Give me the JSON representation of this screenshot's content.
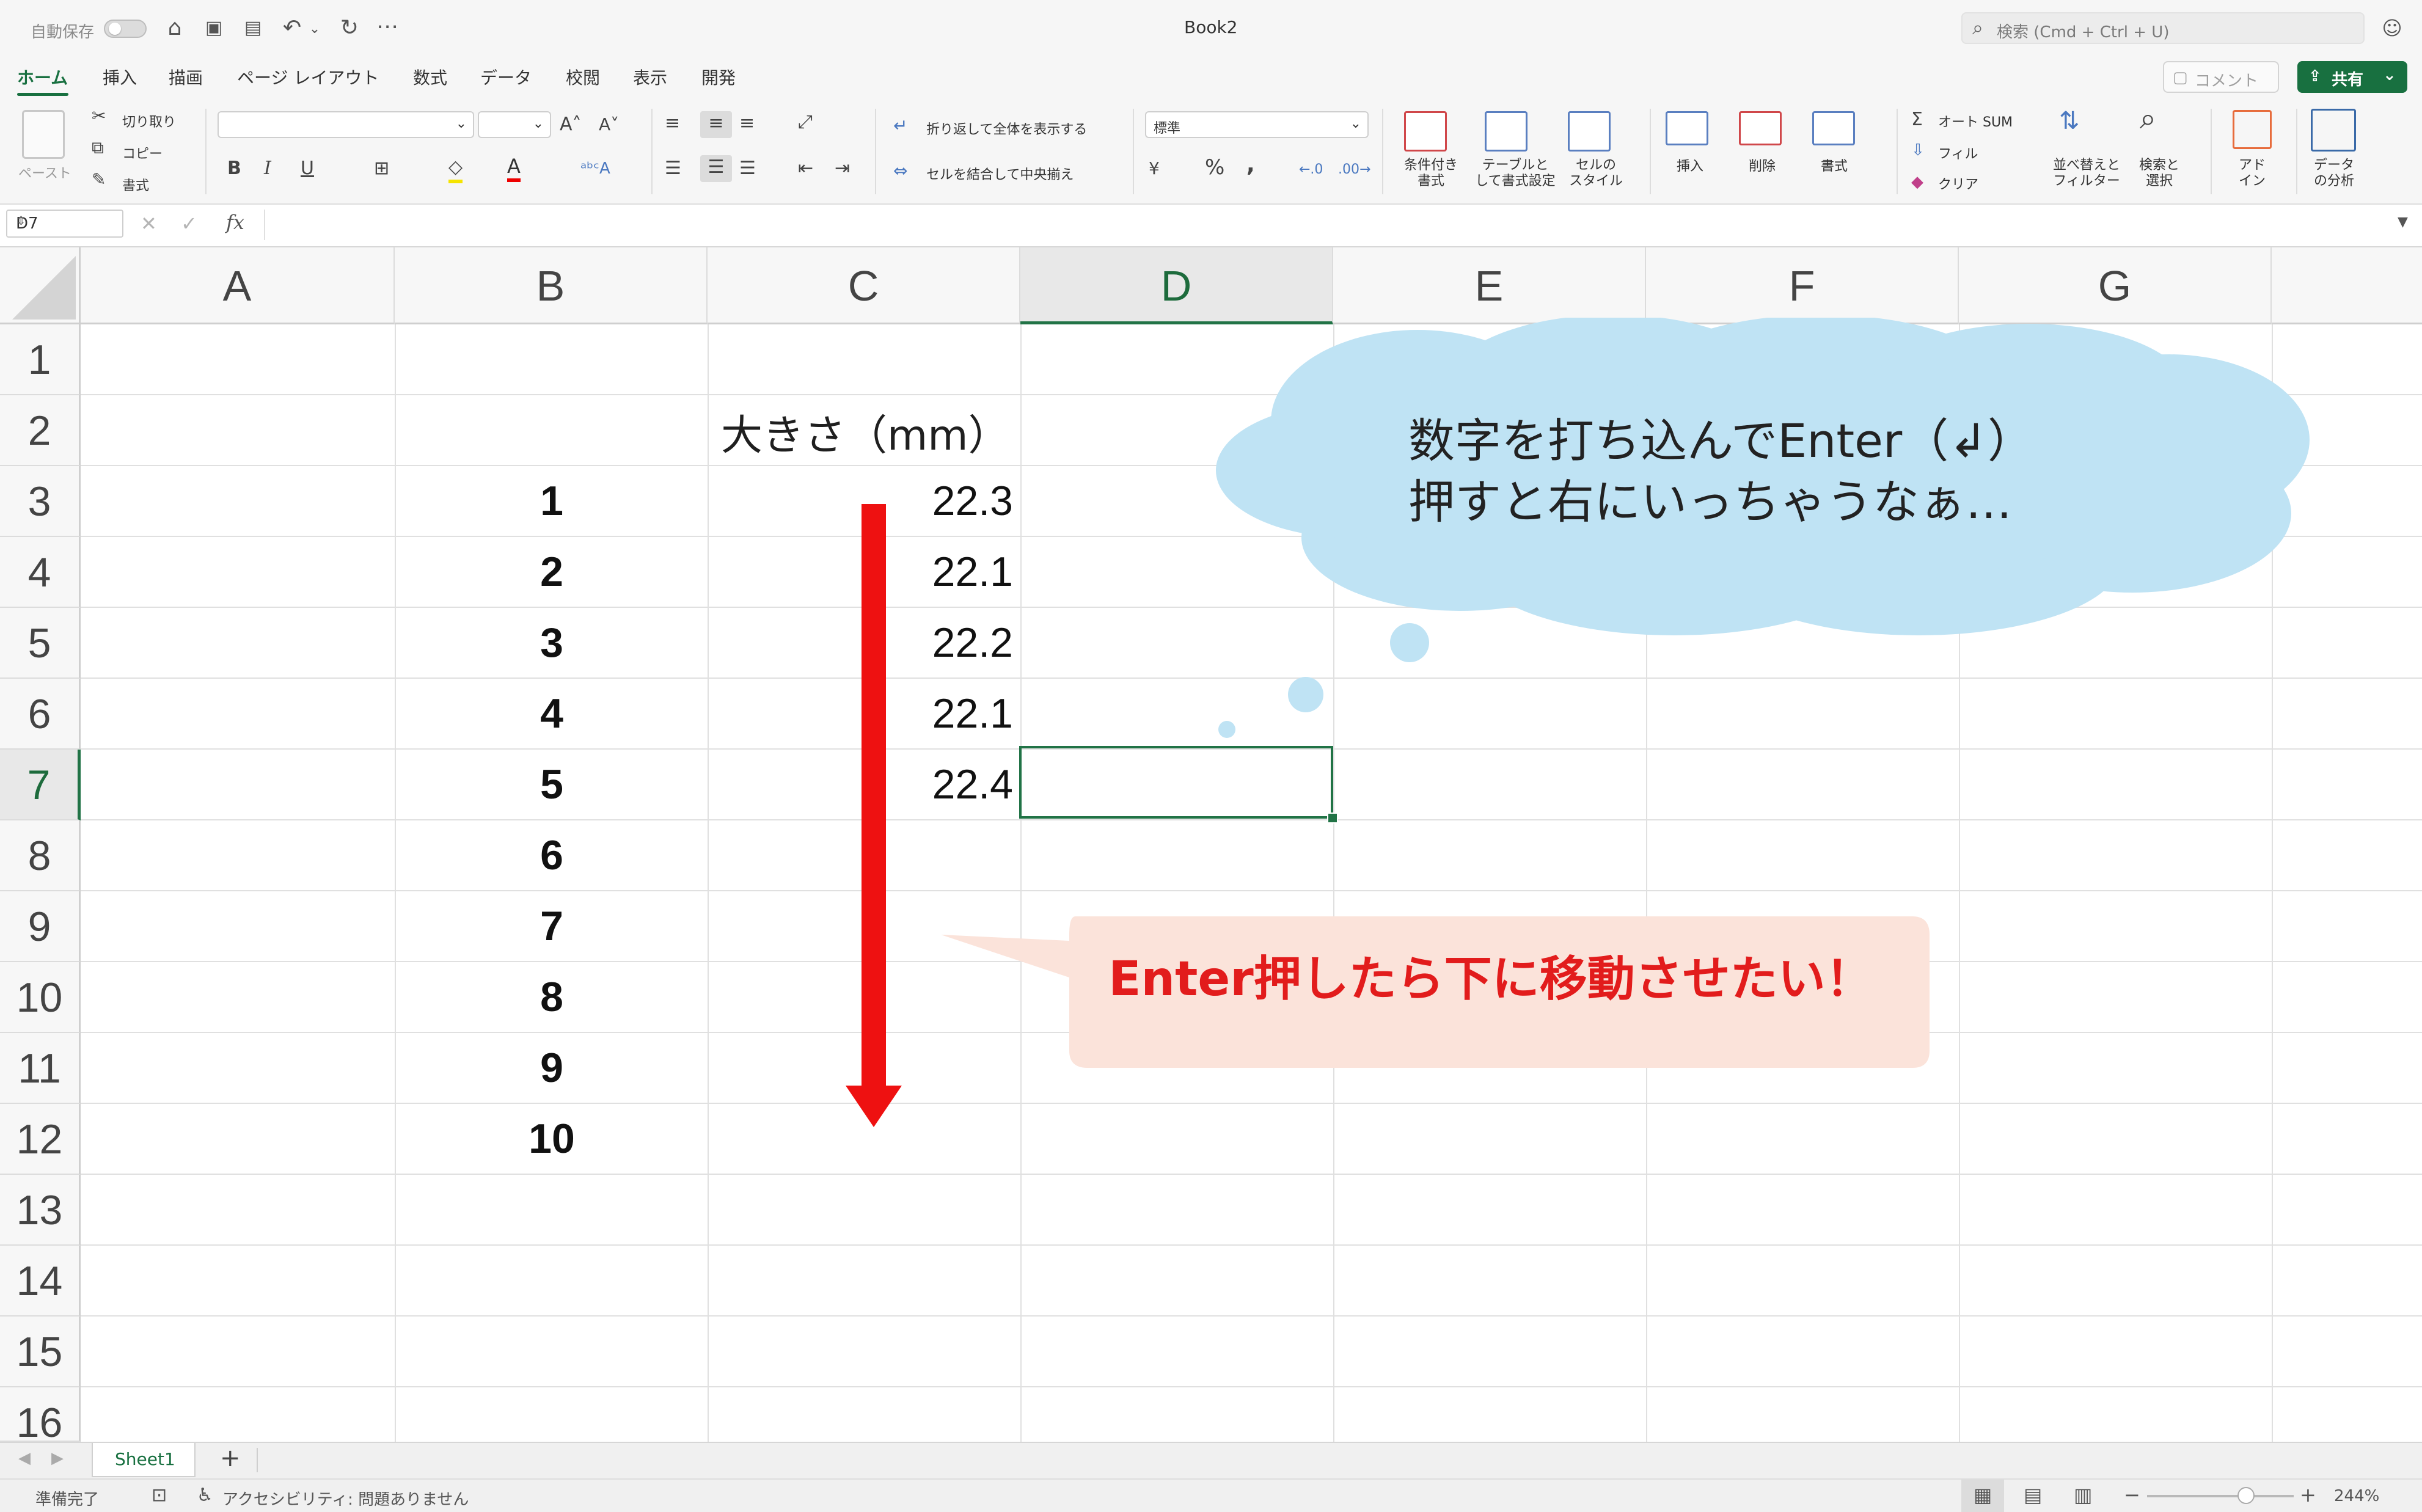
{
  "window": {
    "title": "Book2",
    "autosave_label": "自動保存",
    "search_placeholder": "検索 (Cmd + Ctrl + U)"
  },
  "ribbon_tabs": [
    "ホーム",
    "挿入",
    "描画",
    "ページ レイアウト",
    "数式",
    "データ",
    "校閲",
    "表示",
    "開発"
  ],
  "header_buttons": {
    "comment": "コメント",
    "share": "共有"
  },
  "ribbon": {
    "clipboard": {
      "paste": "ペースト",
      "cut": "切り取り",
      "copy": "コピー",
      "format": "書式"
    },
    "font": {
      "bold": "B",
      "italic": "I",
      "underline": "U",
      "font_name": "",
      "font_size": ""
    },
    "alignment": {
      "wrap": "折り返して全体を表示する",
      "merge": "セルを結合して中央揃え"
    },
    "number": {
      "format": "標準",
      "percent": "%",
      "comma": ","
    },
    "styles": {
      "conditional": "条件付き\n書式",
      "table": "テーブルと\nして書式設定",
      "cell": "セルの\nスタイル"
    },
    "cells": {
      "insert": "挿入",
      "delete": "削除",
      "format": "書式"
    },
    "editing": {
      "autosum": "オート SUM",
      "fill": "フィル",
      "clear": "クリア",
      "sort": "並べ替えと\nフィルター",
      "find": "検索と\n選択"
    },
    "addins": {
      "addin": "アド\nイン",
      "analysis": "データ\nの分析"
    }
  },
  "formula_bar": {
    "name_box": "D7",
    "fx": "fx",
    "formula": ""
  },
  "sheet": {
    "columns": [
      "A",
      "B",
      "C",
      "D",
      "E",
      "F",
      "G"
    ],
    "rows": [
      "1",
      "2",
      "3",
      "4",
      "5",
      "6",
      "7",
      "8",
      "9",
      "10",
      "11",
      "12",
      "13",
      "14",
      "15",
      "16"
    ],
    "selected_cell": "D7",
    "c2_header": "大きさ（mm）",
    "b_values": [
      "1",
      "2",
      "3",
      "4",
      "5",
      "6",
      "7",
      "8",
      "9",
      "10"
    ],
    "c_values": [
      "22.3",
      "22.1",
      "22.2",
      "22.1",
      "22.4"
    ]
  },
  "annotations": {
    "cloud_line1": "数字を打ち込んでEnter（↲）",
    "cloud_line2": "押すと右にいっちゃうなぁ…",
    "callout": "Enter押したら下に移動させたい！",
    "arrow_color": "#ee1111",
    "cloud_color": "#bfe3f4",
    "callout_bg": "#fbe3da"
  },
  "sheet_tabs": {
    "active": "Sheet1",
    "add": "+"
  },
  "status": {
    "ready": "準備完了",
    "accessibility": "アクセシビリティ: 問題ありません",
    "zoom": "244%"
  },
  "accent_color": "#217346"
}
